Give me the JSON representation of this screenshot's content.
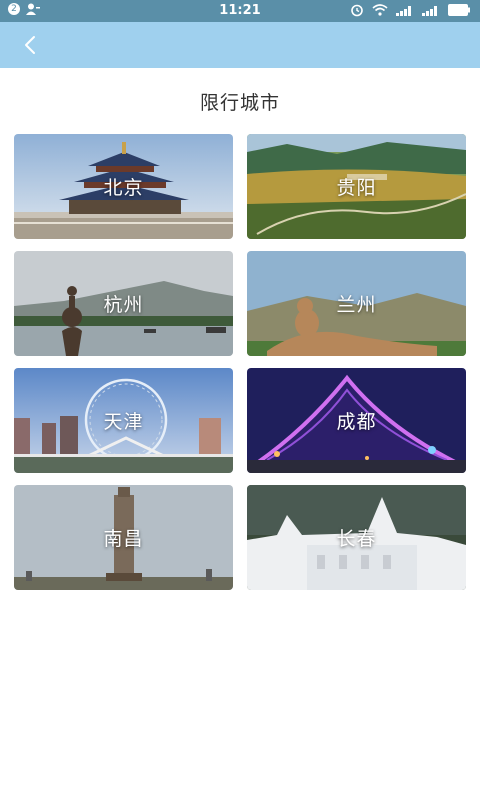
{
  "status_bar": {
    "time": "11:21",
    "left_icons": [
      "notification-icon",
      "user-icon"
    ],
    "right_icons": [
      "alarm-icon",
      "wifi-icon",
      "signal-icon",
      "signal-icon",
      "battery-icon"
    ]
  },
  "nav": {
    "back_icon": "chevron-left-icon"
  },
  "page": {
    "title": "限行城市"
  },
  "cities": [
    {
      "name": "北京"
    },
    {
      "name": "贵阳"
    },
    {
      "name": "杭州"
    },
    {
      "name": "兰州"
    },
    {
      "name": "天津"
    },
    {
      "name": "成都"
    },
    {
      "name": "南昌"
    },
    {
      "name": "长春"
    }
  ],
  "colors": {
    "status_bar": "#5a8fa8",
    "nav_bar": "#9fd0ee",
    "background": "#ffffff"
  }
}
